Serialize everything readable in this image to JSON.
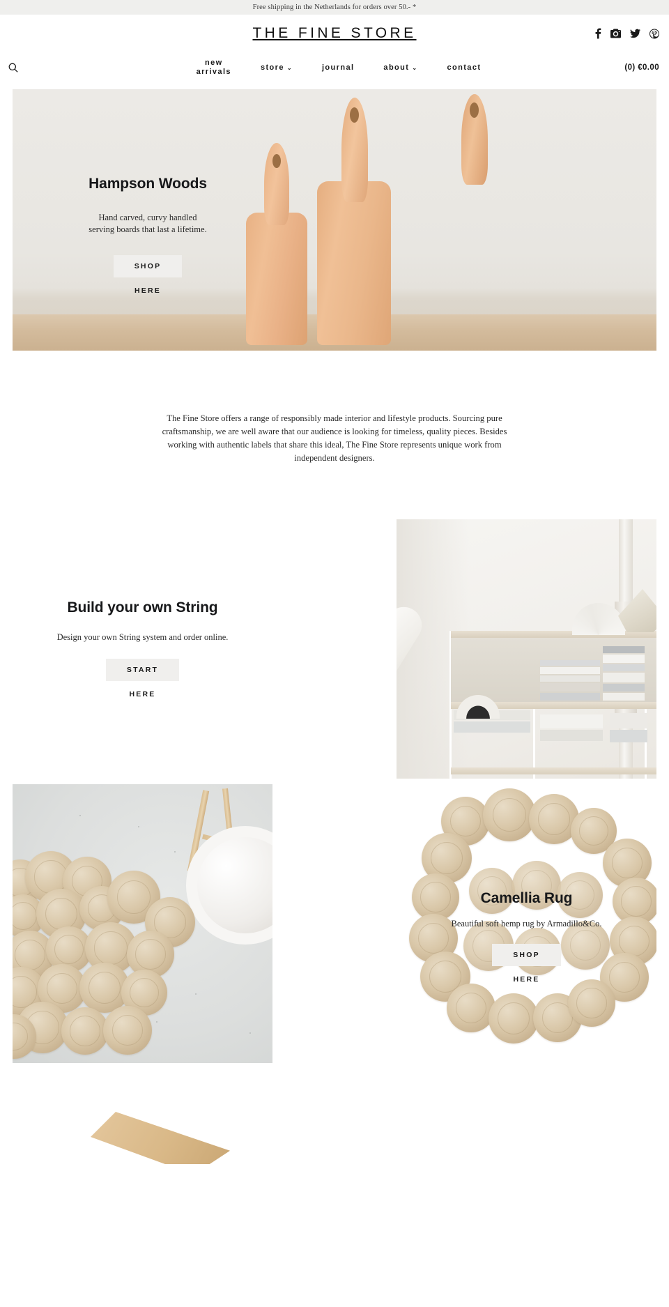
{
  "announcement": {
    "text": "Free shipping in the Netherlands for orders over 50.- *"
  },
  "header": {
    "logo": "THE FINE STORE",
    "social": [
      {
        "name": "facebook-icon",
        "label": "Facebook"
      },
      {
        "name": "instagram-icon",
        "label": "Instagram"
      },
      {
        "name": "twitter-icon",
        "label": "Twitter"
      },
      {
        "name": "pinterest-icon",
        "label": "Pinterest"
      }
    ],
    "search_label": "Search",
    "cart_label": "(0) €0.00",
    "nav": [
      {
        "label": "new\narrivals",
        "caret": ""
      },
      {
        "label": "store",
        "caret": "⌄"
      },
      {
        "label": "journal",
        "caret": ""
      },
      {
        "label": "about",
        "caret": "⌄"
      },
      {
        "label": "contact",
        "caret": ""
      }
    ]
  },
  "hero": {
    "title": "Hampson Woods",
    "subtitle": "Hand carved, curvy handled\nserving boards that last a lifetime.",
    "cta_label": "SHOP",
    "cta_sub_label": "HERE"
  },
  "intro": {
    "paragraph": "The Fine Store offers a range of responsibly made interior and lifestyle products. Sourcing pure craftsmanship, we are well aware that our audience is looking for timeless, quality pieces. Besides working with authentic labels that share this ideal, The Fine Store represents unique work from independent designers."
  },
  "string_section": {
    "title": "Build your own String",
    "subtitle": "Design your own String system and order online.",
    "cta_label": "START",
    "cta_sub_label": "HERE"
  },
  "rug_section": {
    "title": "Camellia Rug",
    "subtitle": "Beautiful soft hemp rug by Armadillo&Co.",
    "cta_label": "SHOP",
    "cta_sub_label": "HERE"
  },
  "colors": {
    "announcement_bg": "#efefed",
    "button_bg": "#f0efed",
    "text": "#1a1a1a",
    "page_bg": "#ffffff"
  }
}
